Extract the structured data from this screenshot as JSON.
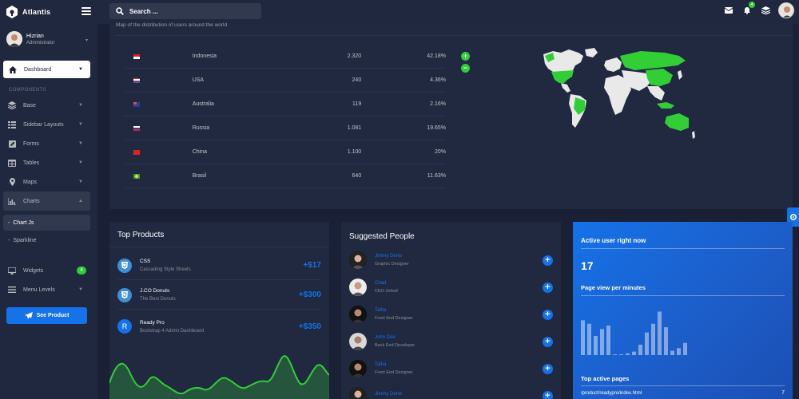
{
  "app": {
    "name": "Atlantis"
  },
  "search": {
    "placeholder": "Search ..."
  },
  "topbar": {
    "notification_count": "4"
  },
  "user": {
    "name": "Hizrian",
    "role": "Administrator"
  },
  "sidebar": {
    "dashboard_label": "Dashboard",
    "section_label": "COMPONENTS",
    "items": [
      {
        "label": "Base",
        "icon": "layers-icon"
      },
      {
        "label": "Sidebar Layouts",
        "icon": "th-list-icon"
      },
      {
        "label": "Forms",
        "icon": "pen-square-icon"
      },
      {
        "label": "Tables",
        "icon": "table-icon"
      },
      {
        "label": "Maps",
        "icon": "map-marker-icon"
      },
      {
        "label": "Charts",
        "icon": "chart-bar-icon"
      }
    ],
    "sub_items": [
      {
        "label": "Chart Js"
      },
      {
        "label": "Sparkline"
      }
    ],
    "widgets_label": "Widgets",
    "widgets_badge": "4",
    "menu_levels_label": "Menu Levels",
    "see_product_label": "See Product"
  },
  "map_card": {
    "subtitle": "Map of the distribution of users around the world",
    "countries": [
      {
        "name": "Indonesia",
        "count": "2.320",
        "percent": "42.18%",
        "flag": "indonesia"
      },
      {
        "name": "USA",
        "count": "240",
        "percent": "4.36%",
        "flag": "usa"
      },
      {
        "name": "Australia",
        "count": "119",
        "percent": "2.16%",
        "flag": "australia"
      },
      {
        "name": "Russia",
        "count": "1.081",
        "percent": "19.65%",
        "flag": "russia"
      },
      {
        "name": "China",
        "count": "1.100",
        "percent": "20%",
        "flag": "china"
      },
      {
        "name": "Brasil",
        "count": "640",
        "percent": "11.63%",
        "flag": "brazil"
      }
    ],
    "zoom_in": "+",
    "zoom_out": "−"
  },
  "top_products": {
    "title": "Top Products",
    "items": [
      {
        "name": "CSS",
        "desc": "Cascading Style Sheets",
        "price": "+$17",
        "icon": "css3-icon"
      },
      {
        "name": "J.CO Donuts",
        "desc": "The Best Donuts",
        "price": "+$300",
        "icon": "css3-icon"
      },
      {
        "name": "Ready Pro",
        "desc": "Bootstrap 4 Admin Dashboard",
        "price": "+$350",
        "icon": "R"
      }
    ]
  },
  "suggested_people": {
    "title": "Suggested People",
    "people": [
      {
        "name": "Jimmy Denis",
        "role": "Graphic Designer"
      },
      {
        "name": "Chad",
        "role": "CEO Zeleaf"
      },
      {
        "name": "Talha",
        "role": "Front End Designer"
      },
      {
        "name": "John Doe",
        "role": "Back End Developer"
      },
      {
        "name": "Talha",
        "role": "Front End Designer"
      },
      {
        "name": "Jimmy Denis",
        "role": ""
      }
    ]
  },
  "active_users": {
    "title": "Active user right now",
    "value": "17",
    "pageview_title": "Page view per minutes",
    "pageview_bars": [
      40,
      36,
      22,
      30,
      34,
      0,
      0,
      2,
      4,
      12,
      26,
      36,
      50,
      32,
      5,
      8,
      14
    ],
    "top_pages_title": "Top active pages",
    "top_pages": [
      {
        "url": "/product/readypro/index.html",
        "count": "7"
      }
    ]
  },
  "colors": {
    "accent": "#1572e8",
    "success": "#31ce36",
    "bg": "#1a2035",
    "card": "#202940"
  }
}
